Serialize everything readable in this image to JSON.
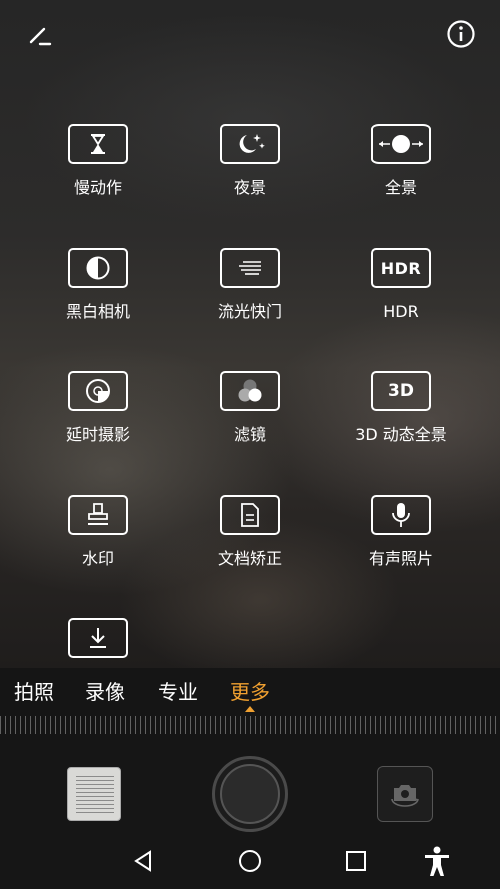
{
  "top_bar": {
    "edit_icon": "pencil-icon",
    "info_icon": "info-icon"
  },
  "modes": [
    {
      "label": "慢动作",
      "icon": "hourglass-icon"
    },
    {
      "label": "夜景",
      "icon": "moon-stars-icon"
    },
    {
      "label": "全景",
      "icon": "panorama-icon"
    },
    {
      "label": "黑白相机",
      "icon": "half-circle-icon"
    },
    {
      "label": "流光快门",
      "icon": "light-streak-icon"
    },
    {
      "label": "HDR",
      "icon": "hdr-icon",
      "icon_text": "HDR"
    },
    {
      "label": "延时摄影",
      "icon": "timelapse-icon"
    },
    {
      "label": "滤镜",
      "icon": "filter-circles-icon"
    },
    {
      "label": "3D 动态全景",
      "icon": "3d-icon",
      "icon_text": "3D"
    },
    {
      "label": "水印",
      "icon": "stamp-icon"
    },
    {
      "label": "文档矫正",
      "icon": "document-icon"
    },
    {
      "label": "有声照片",
      "icon": "microphone-icon"
    },
    {
      "label": "",
      "icon": "download-icon"
    }
  ],
  "mode_tabs": [
    {
      "label": "拍照",
      "active": false
    },
    {
      "label": "录像",
      "active": false
    },
    {
      "label": "专业",
      "active": false
    },
    {
      "label": "更多",
      "active": true
    }
  ],
  "colors": {
    "accent": "#f0a030",
    "background": "#161616"
  },
  "controls": {
    "gallery_icon": "gallery-thumbnail",
    "shutter_icon": "shutter-button",
    "switch_icon": "switch-camera-icon"
  },
  "nav": {
    "back_icon": "back-triangle-icon",
    "home_icon": "home-circle-icon",
    "recents_icon": "recents-square-icon",
    "accessibility_icon": "accessibility-icon"
  }
}
